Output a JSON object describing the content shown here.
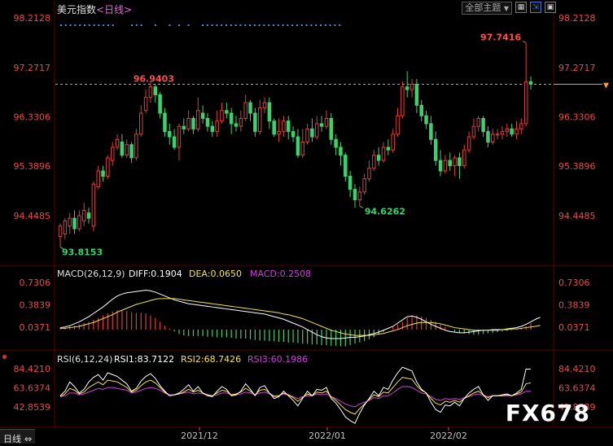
{
  "header": {
    "symbol": "美元指数",
    "period": "<日线>",
    "period_selector_label": "全部主题",
    "period_selector_caret": "▼"
  },
  "toolbar_icons": [
    "grid-icon",
    "zoom-icon",
    "restore-icon"
  ],
  "footer": {
    "tab_label": "日线",
    "tab_marker": "⇔"
  },
  "watermark": "FX678",
  "price_panel": {
    "yticks": [
      "98.2128",
      "97.2717",
      "96.3306",
      "95.3896",
      "94.4485"
    ],
    "ytick_values": [
      98.2128,
      97.2717,
      96.3306,
      95.3896,
      94.4485
    ],
    "annotations": {
      "high": "97.7416",
      "mid_high": "96.9403",
      "low": "93.8153",
      "mid_low": "94.6262"
    },
    "last_price_marker": "▼"
  },
  "macd_panel": {
    "title_main": "MACD(26,12,9)",
    "diff": "DIFF:0.1904",
    "dea": "DEA:0.0650",
    "macd": "MACD:0.2508",
    "yticks": [
      "0.7306",
      "0.3839",
      "0.0371"
    ]
  },
  "rsi_panel": {
    "title_main": "RSI(6,12,24)",
    "rsi1": "RSI1:83.7122",
    "rsi2": "RSI2:68.7426",
    "rsi3": "RSI3:60.1986",
    "yticks": [
      "84.4210",
      "63.6374",
      "42.8539"
    ]
  },
  "xticks": [
    "2021/12",
    "2022/01",
    "2022/02"
  ],
  "colors": {
    "up": "#e23b3b",
    "down": "#3ad16e",
    "diff": "#ffffff",
    "dea": "#f5e642",
    "rsi3": "#d23ce0",
    "axis": "#e84a4a",
    "grid": "#3a0000"
  },
  "chart_data": {
    "type": "candlestick",
    "ohlc": [
      [
        94.05,
        94.25,
        93.85,
        94.3
      ],
      [
        94.1,
        94.35,
        94.0,
        94.4
      ],
      [
        94.25,
        94.4,
        94.1,
        94.5
      ],
      [
        94.4,
        94.2,
        94.1,
        94.55
      ],
      [
        94.2,
        94.45,
        94.15,
        94.55
      ],
      [
        94.35,
        94.55,
        94.25,
        94.7
      ],
      [
        94.5,
        94.4,
        94.3,
        94.6
      ],
      [
        94.25,
        95.05,
        94.15,
        95.1
      ],
      [
        95.0,
        95.3,
        94.95,
        95.4
      ],
      [
        95.3,
        95.2,
        95.1,
        95.4
      ],
      [
        95.2,
        95.55,
        95.15,
        95.6
      ],
      [
        95.5,
        95.75,
        95.4,
        95.85
      ],
      [
        95.75,
        95.9,
        95.7,
        96.0
      ],
      [
        95.85,
        95.6,
        95.55,
        96.0
      ],
      [
        95.6,
        95.8,
        95.55,
        95.9
      ],
      [
        95.8,
        95.55,
        95.45,
        95.85
      ],
      [
        95.55,
        96.0,
        95.5,
        96.1
      ],
      [
        96.0,
        96.4,
        95.95,
        96.55
      ],
      [
        96.45,
        96.7,
        96.4,
        96.85
      ],
      [
        96.7,
        96.9,
        96.6,
        97.0
      ],
      [
        96.9,
        96.75,
        96.6,
        96.95
      ],
      [
        96.75,
        96.4,
        96.3,
        96.8
      ],
      [
        96.4,
        96.05,
        95.95,
        96.5
      ],
      [
        96.05,
        95.95,
        95.8,
        96.2
      ],
      [
        95.95,
        95.75,
        95.7,
        96.1
      ],
      [
        95.75,
        96.15,
        95.5,
        96.2
      ],
      [
        96.15,
        96.1,
        96.0,
        96.3
      ],
      [
        96.1,
        96.3,
        96.05,
        96.45
      ],
      [
        96.3,
        96.1,
        96.0,
        96.35
      ],
      [
        96.1,
        96.45,
        96.05,
        96.7
      ],
      [
        96.4,
        96.3,
        96.2,
        96.55
      ],
      [
        96.3,
        96.15,
        96.05,
        96.4
      ],
      [
        96.15,
        96.05,
        95.95,
        96.25
      ],
      [
        96.05,
        96.25,
        95.95,
        96.45
      ],
      [
        96.25,
        96.45,
        96.2,
        96.6
      ],
      [
        96.45,
        96.4,
        96.3,
        96.6
      ],
      [
        96.4,
        96.2,
        96.0,
        96.5
      ],
      [
        96.2,
        96.15,
        96.05,
        96.35
      ],
      [
        96.15,
        96.3,
        96.05,
        96.45
      ],
      [
        96.3,
        96.6,
        96.25,
        96.75
      ],
      [
        96.6,
        96.4,
        96.25,
        96.65
      ],
      [
        96.4,
        96.05,
        95.95,
        96.5
      ],
      [
        96.05,
        96.5,
        96.0,
        96.65
      ],
      [
        96.5,
        96.6,
        96.4,
        96.7
      ],
      [
        96.6,
        96.25,
        96.1,
        96.7
      ],
      [
        96.25,
        96.0,
        95.95,
        96.3
      ],
      [
        96.0,
        96.05,
        95.85,
        96.3
      ],
      [
        96.05,
        96.25,
        95.95,
        96.35
      ],
      [
        96.25,
        96.05,
        95.9,
        96.35
      ],
      [
        96.05,
        95.95,
        95.85,
        96.15
      ],
      [
        95.95,
        95.6,
        95.55,
        96.1
      ],
      [
        95.6,
        95.85,
        95.55,
        96.1
      ],
      [
        95.85,
        96.1,
        95.8,
        96.2
      ],
      [
        96.1,
        95.95,
        95.85,
        96.3
      ],
      [
        95.95,
        96.2,
        95.9,
        96.35
      ],
      [
        96.2,
        96.15,
        96.05,
        96.35
      ],
      [
        96.15,
        96.3,
        96.1,
        96.45
      ],
      [
        96.3,
        95.9,
        95.8,
        96.4
      ],
      [
        95.9,
        95.75,
        95.6,
        96.0
      ],
      [
        95.75,
        95.6,
        95.4,
        95.85
      ],
      [
        95.6,
        95.2,
        95.1,
        95.65
      ],
      [
        95.2,
        94.95,
        94.8,
        95.3
      ],
      [
        94.95,
        94.75,
        94.6,
        95.05
      ],
      [
        94.75,
        94.9,
        94.63,
        95.0
      ],
      [
        94.9,
        95.15,
        94.85,
        95.25
      ],
      [
        95.15,
        95.35,
        95.1,
        95.5
      ],
      [
        95.35,
        95.6,
        95.3,
        95.7
      ],
      [
        95.6,
        95.5,
        95.4,
        95.75
      ],
      [
        95.5,
        95.75,
        95.45,
        95.85
      ],
      [
        95.75,
        95.7,
        95.6,
        95.9
      ],
      [
        95.7,
        96.0,
        95.65,
        96.1
      ],
      [
        96.0,
        96.35,
        95.95,
        96.5
      ],
      [
        96.35,
        96.9,
        96.3,
        97.0
      ],
      [
        96.9,
        96.85,
        96.7,
        97.2
      ],
      [
        96.85,
        96.95,
        96.7,
        97.05
      ],
      [
        96.95,
        96.55,
        96.4,
        97.05
      ],
      [
        96.55,
        96.35,
        96.25,
        96.65
      ],
      [
        96.35,
        96.2,
        96.1,
        96.45
      ],
      [
        96.2,
        95.9,
        95.8,
        96.35
      ],
      [
        95.9,
        95.5,
        95.4,
        96.05
      ],
      [
        95.5,
        95.3,
        95.2,
        95.7
      ],
      [
        95.3,
        95.5,
        95.25,
        95.6
      ],
      [
        95.5,
        95.4,
        95.3,
        95.65
      ],
      [
        95.4,
        95.55,
        95.2,
        95.6
      ],
      [
        95.55,
        95.4,
        95.15,
        95.65
      ],
      [
        95.4,
        95.7,
        95.35,
        95.8
      ],
      [
        95.7,
        95.95,
        95.65,
        96.05
      ],
      [
        95.95,
        96.15,
        95.9,
        96.3
      ],
      [
        96.15,
        96.3,
        96.05,
        96.35
      ],
      [
        96.3,
        96.05,
        95.95,
        96.35
      ],
      [
        96.05,
        95.85,
        95.75,
        96.15
      ],
      [
        95.85,
        96.0,
        95.8,
        96.1
      ],
      [
        96.0,
        96.0,
        95.9,
        96.1
      ],
      [
        96.0,
        96.05,
        95.9,
        96.15
      ],
      [
        96.05,
        96.1,
        95.95,
        96.2
      ],
      [
        96.1,
        96.0,
        95.95,
        96.2
      ],
      [
        96.0,
        96.1,
        95.9,
        96.25
      ],
      [
        96.1,
        96.2,
        96.0,
        96.3
      ],
      [
        96.2,
        97.0,
        96.15,
        97.74
      ],
      [
        97.0,
        96.95,
        96.85,
        97.1
      ]
    ],
    "macd_hist": [
      0.02,
      0.03,
      0.05,
      0.06,
      0.08,
      0.1,
      0.12,
      0.15,
      0.18,
      0.22,
      0.25,
      0.28,
      0.3,
      0.3,
      0.29,
      0.27,
      0.26,
      0.26,
      0.25,
      0.22,
      0.18,
      0.12,
      0.06,
      0.02,
      -0.03,
      -0.07,
      -0.09,
      -0.1,
      -0.1,
      -0.1,
      -0.1,
      -0.11,
      -0.11,
      -0.12,
      -0.12,
      -0.12,
      -0.13,
      -0.14,
      -0.14,
      -0.14,
      -0.15,
      -0.16,
      -0.17,
      -0.17,
      -0.18,
      -0.18,
      -0.19,
      -0.19,
      -0.2,
      -0.2,
      -0.21,
      -0.22,
      -0.22,
      -0.23,
      -0.23,
      -0.24,
      -0.24,
      -0.25,
      -0.25,
      -0.26,
      -0.26,
      -0.24,
      -0.22,
      -0.2,
      -0.18,
      -0.15,
      -0.12,
      -0.08,
      -0.04,
      0.0,
      0.04,
      0.08,
      0.12,
      0.18,
      0.22,
      0.22,
      0.2,
      0.18,
      0.15,
      0.12,
      0.08,
      0.04,
      0.0,
      -0.03,
      -0.05,
      -0.06,
      -0.07,
      -0.08,
      -0.08,
      -0.07,
      -0.06,
      -0.05,
      -0.04,
      -0.03,
      -0.02,
      -0.01,
      0.01,
      0.02,
      0.05,
      0.1,
      0.15,
      0.2
    ],
    "diff": [
      0.03,
      0.04,
      0.06,
      0.09,
      0.12,
      0.16,
      0.2,
      0.25,
      0.3,
      0.35,
      0.41,
      0.47,
      0.52,
      0.55,
      0.57,
      0.58,
      0.59,
      0.6,
      0.61,
      0.6,
      0.58,
      0.55,
      0.52,
      0.49,
      0.46,
      0.44,
      0.42,
      0.4,
      0.39,
      0.38,
      0.37,
      0.36,
      0.35,
      0.34,
      0.33,
      0.32,
      0.31,
      0.3,
      0.29,
      0.28,
      0.27,
      0.26,
      0.25,
      0.24,
      0.22,
      0.2,
      0.18,
      0.16,
      0.13,
      0.1,
      0.07,
      0.04,
      0.0,
      -0.04,
      -0.08,
      -0.11,
      -0.13,
      -0.14,
      -0.14,
      -0.14,
      -0.13,
      -0.12,
      -0.12,
      -0.11,
      -0.1,
      -0.08,
      -0.06,
      -0.04,
      -0.01,
      0.02,
      0.05,
      0.1,
      0.15,
      0.2,
      0.21,
      0.19,
      0.16,
      0.12,
      0.08,
      0.05,
      0.02,
      -0.01,
      -0.03,
      -0.04,
      -0.05,
      -0.05,
      -0.04,
      -0.03,
      -0.02,
      -0.01,
      -0.01,
      0.0,
      0.0,
      0.0,
      0.01,
      0.02,
      0.03,
      0.05,
      0.08,
      0.12,
      0.16,
      0.19
    ],
    "dea": [
      0.02,
      0.02,
      0.03,
      0.04,
      0.05,
      0.07,
      0.09,
      0.11,
      0.14,
      0.17,
      0.2,
      0.23,
      0.27,
      0.3,
      0.33,
      0.36,
      0.39,
      0.41,
      0.43,
      0.45,
      0.47,
      0.48,
      0.48,
      0.48,
      0.48,
      0.47,
      0.46,
      0.45,
      0.44,
      0.43,
      0.42,
      0.41,
      0.4,
      0.39,
      0.38,
      0.37,
      0.36,
      0.35,
      0.34,
      0.33,
      0.32,
      0.31,
      0.3,
      0.29,
      0.28,
      0.27,
      0.26,
      0.24,
      0.23,
      0.21,
      0.19,
      0.17,
      0.14,
      0.11,
      0.08,
      0.05,
      0.02,
      -0.01,
      -0.03,
      -0.05,
      -0.07,
      -0.08,
      -0.09,
      -0.09,
      -0.09,
      -0.09,
      -0.08,
      -0.07,
      -0.06,
      -0.04,
      -0.02,
      0.0,
      0.03,
      0.06,
      0.08,
      0.1,
      0.11,
      0.11,
      0.11,
      0.1,
      0.09,
      0.07,
      0.05,
      0.03,
      0.02,
      0.01,
      0.0,
      -0.01,
      -0.01,
      -0.01,
      -0.01,
      -0.01,
      -0.01,
      0.0,
      0.0,
      0.01,
      0.01,
      0.02,
      0.03,
      0.04,
      0.05,
      0.065
    ],
    "rsi1": [
      55,
      60,
      70,
      65,
      58,
      62,
      70,
      75,
      78,
      72,
      80,
      78,
      76,
      72,
      68,
      60,
      63,
      71,
      76,
      79,
      74,
      66,
      60,
      55,
      56,
      58,
      62,
      67,
      60,
      65,
      58,
      55,
      54,
      60,
      65,
      62,
      55,
      56,
      60,
      68,
      62,
      55,
      64,
      66,
      58,
      52,
      54,
      60,
      55,
      50,
      44,
      52,
      60,
      55,
      62,
      61,
      64,
      52,
      47,
      40,
      32,
      28,
      25,
      36,
      45,
      52,
      60,
      55,
      64,
      62,
      72,
      80,
      86,
      84,
      82,
      70,
      62,
      58,
      48,
      40,
      37,
      45,
      44,
      48,
      44,
      52,
      58,
      62,
      65,
      56,
      50,
      55,
      55,
      56,
      57,
      55,
      58,
      62,
      84,
      84
    ],
    "rsi2": [
      54,
      57,
      63,
      61,
      57,
      59,
      64,
      67,
      70,
      67,
      72,
      71,
      70,
      67,
      64,
      59,
      61,
      66,
      70,
      72,
      69,
      64,
      59,
      55,
      56,
      57,
      59,
      62,
      59,
      61,
      58,
      56,
      55,
      58,
      61,
      60,
      56,
      57,
      59,
      63,
      60,
      56,
      61,
      62,
      58,
      54,
      55,
      58,
      56,
      53,
      49,
      53,
      57,
      55,
      59,
      58,
      60,
      54,
      50,
      45,
      40,
      37,
      35,
      41,
      46,
      51,
      56,
      54,
      59,
      58,
      64,
      70,
      75,
      74,
      73,
      66,
      61,
      58,
      52,
      47,
      45,
      49,
      48,
      50,
      48,
      52,
      55,
      58,
      60,
      56,
      53,
      55,
      55,
      55,
      56,
      55,
      57,
      59,
      68,
      69
    ],
    "rsi3": [
      54,
      55,
      58,
      58,
      56,
      57,
      59,
      61,
      63,
      62,
      64,
      64,
      63,
      62,
      61,
      58,
      59,
      61,
      63,
      64,
      63,
      61,
      58,
      56,
      56,
      57,
      58,
      59,
      57,
      58,
      57,
      56,
      55,
      56,
      58,
      58,
      56,
      56,
      57,
      59,
      58,
      56,
      58,
      59,
      57,
      55,
      55,
      57,
      56,
      54,
      52,
      54,
      55,
      55,
      57,
      56,
      57,
      54,
      52,
      49,
      46,
      44,
      43,
      46,
      48,
      50,
      53,
      52,
      55,
      55,
      58,
      62,
      65,
      65,
      64,
      61,
      58,
      57,
      54,
      51,
      50,
      52,
      51,
      52,
      51,
      53,
      54,
      56,
      57,
      55,
      54,
      55,
      55,
      55,
      55,
      55,
      56,
      57,
      60,
      60
    ]
  }
}
